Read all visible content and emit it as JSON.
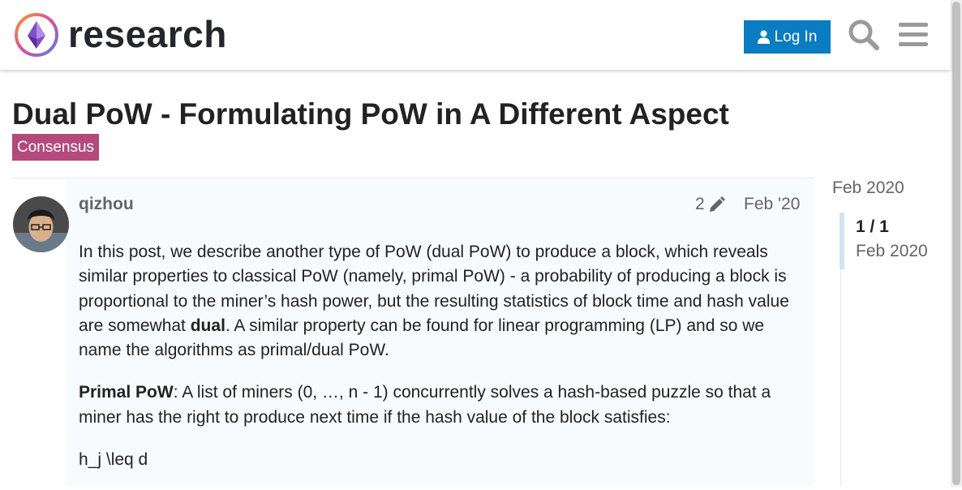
{
  "header": {
    "site_name": "research",
    "login_label": "Log In",
    "icons": [
      "site-logo",
      "user-icon",
      "search-icon",
      "hamburger-menu-icon"
    ]
  },
  "topic": {
    "title": "Dual PoW - Formulating PoW in A Different Aspect",
    "category": "Consensus",
    "category_color": "#b3497c"
  },
  "post": {
    "username": "qizhou",
    "edit_count": "2",
    "date": "Feb '20",
    "p1_before": "In this post, we describe another type of PoW (dual PoW) to produce a block, which reveals similar properties to classical PoW (namely, primal PoW) - a probability of producing a block is proportional to the miner’s hash power, but the resulting statistics of block time and hash value are somewhat ",
    "p1_bold": "dual",
    "p1_after": ". A similar property can be found for linear programming (LP) and so we name the algorithms as primal/dual PoW.",
    "p2_bold": "Primal PoW",
    "p2_after": ": A list of miners (0, …, n - 1) concurrently solves a hash-based puzzle so that a miner has the right to produce next time if the hash value of the block satisfies:",
    "p3": "h_j \\leq d"
  },
  "timeline": {
    "top_date": "Feb 2020",
    "position": "1 / 1",
    "bottom_date": "Feb 2020"
  },
  "colors": {
    "accent": "#0a7cc1",
    "muted_text": "#646464"
  }
}
